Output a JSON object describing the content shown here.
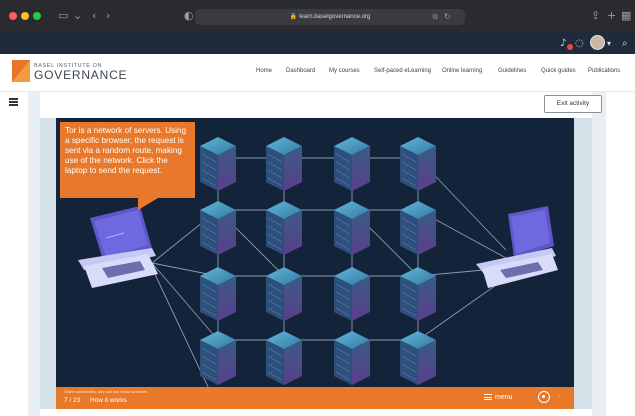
{
  "browser": {
    "url": "learn.baselgovernance.org",
    "traffic_colors": [
      "#fe5f57",
      "#febc2e",
      "#28c840"
    ]
  },
  "topbar": {
    "bg": "#1f2b3b",
    "icons": [
      "notifications-icon",
      "chat-icon",
      "user-avatar",
      "search-icon"
    ]
  },
  "site": {
    "logo_top": "BASEL INSTITUTE ON",
    "logo_bottom": "GOVERNANCE",
    "nav": [
      "Home",
      "Dashboard",
      "My courses",
      "Self-paced eLearning",
      "Online learning",
      "Guidelines",
      "Quick guides",
      "Publications"
    ],
    "accent": "#e8792a"
  },
  "page": {
    "exit_label": "Exit activity"
  },
  "slide": {
    "callout": "Tor is a network of servers. Using a specific browser, the request is sent via a random route, making use of the network. Click the laptop to send the request.",
    "footer_small": "Online communities, dark web and virtual currencies",
    "page_counter": "7 / 23",
    "footer_title": "How it works",
    "menu_label": "menu",
    "bg": "#13243a"
  }
}
